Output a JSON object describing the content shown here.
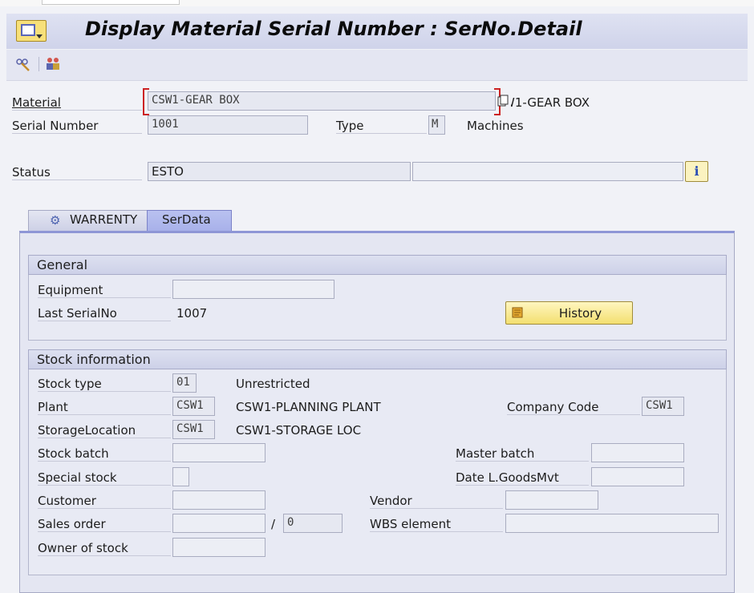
{
  "window": {
    "title": "Display Material Serial Number : SerNo.Detail"
  },
  "toolbar": {
    "icon1": "change-display-icon",
    "icon2": "users-icon"
  },
  "header": {
    "material_label": "Material",
    "material_value": "CSW1-GEAR BOX",
    "material_desc": "CSW1-GEAR BOX",
    "serial_label": "Serial Number",
    "serial_value": "1001",
    "type_label": "Type",
    "type_value": "M",
    "type_desc": "Machines",
    "status_label": "Status",
    "status_value": "ESTO",
    "status_value2": "",
    "info_glyph": "i"
  },
  "tabs": [
    {
      "label": "WARRENTY"
    },
    {
      "label": "SerData"
    }
  ],
  "general": {
    "title": "General",
    "equipment_label": "Equipment",
    "equipment_value": "",
    "last_serial_label": "Last SerialNo",
    "last_serial_value": "1007",
    "history_label": "History"
  },
  "stock": {
    "title": "Stock information",
    "stock_type_label": "Stock type",
    "stock_type_value": "01",
    "stock_type_desc": "Unrestricted",
    "plant_label": "Plant",
    "plant_value": "CSW1",
    "plant_desc": "CSW1-PLANNING PLANT",
    "company_code_label": "Company Code",
    "company_code_value": "CSW1",
    "storage_label": "StorageLocation",
    "storage_value": "CSW1",
    "storage_desc": "CSW1-STORAGE LOC",
    "stock_batch_label": "Stock batch",
    "master_batch_label": "Master batch",
    "special_stock_label": "Special stock",
    "date_goods_label": "Date L.GoodsMvt",
    "customer_label": "Customer",
    "vendor_label": "Vendor",
    "sales_order_label": "Sales order",
    "sales_order_sep": "/",
    "sales_order_item": "0",
    "wbs_label": "WBS element",
    "owner_label": "Owner of stock"
  }
}
